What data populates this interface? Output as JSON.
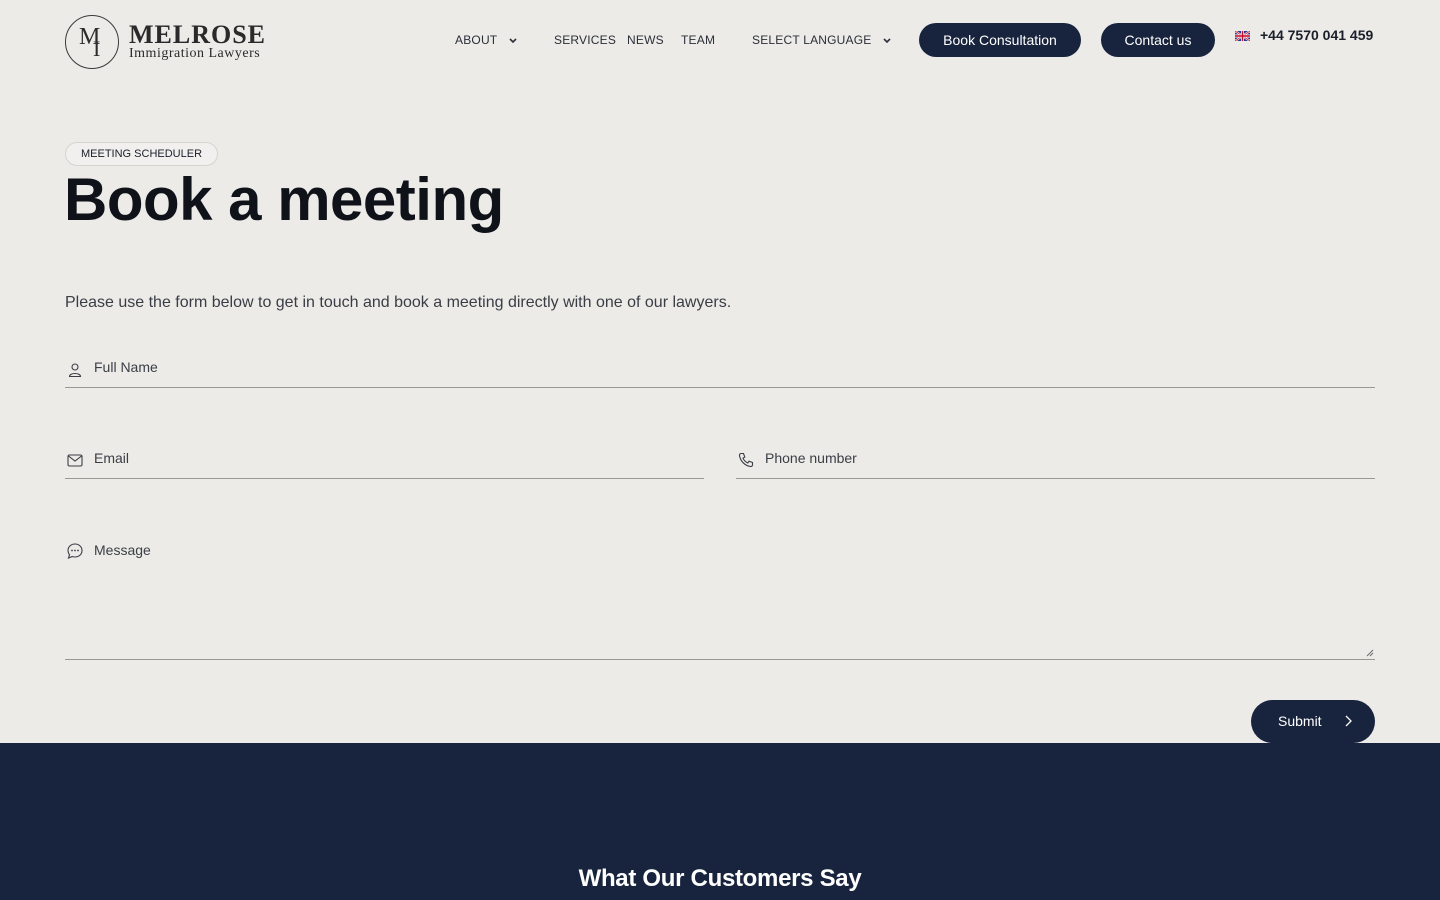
{
  "header": {
    "logo": {
      "monogram_m": "M",
      "monogram_i": "I",
      "brand": "MELROSE",
      "tagline": "Immigration Lawyers"
    },
    "nav": {
      "about": "ABOUT",
      "services": "SERVICES",
      "news": "NEWS",
      "team": "TEAM",
      "language": "SELECT LANGUAGE"
    },
    "book_button": "Book Consultation",
    "contact_button": "Contact us",
    "flag_icon": "uk-flag-icon",
    "phone": "+44 7570 041 459"
  },
  "hero": {
    "badge": "MEETING SCHEDULER",
    "title": "Book a meeting",
    "intro": "Please use the form below to get in touch and book a meeting directly with one of our lawyers."
  },
  "form": {
    "full_name_placeholder": "Full Name",
    "email_placeholder": "Email",
    "phone_placeholder": "Phone number",
    "message_placeholder": "Message",
    "submit_label": "Submit"
  },
  "testimonials": {
    "heading": "What Our Customers Say"
  },
  "colors": {
    "background": "#ecebe8",
    "navy": "#18243d",
    "text": "#1b1f2a"
  }
}
